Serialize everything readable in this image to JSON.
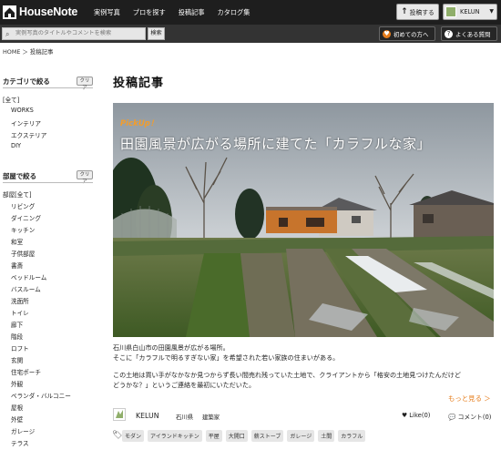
{
  "header": {
    "logo_text": "HouseNote",
    "nav": [
      "実例写真",
      "プロを探す",
      "投稿記事",
      "カタログ集"
    ],
    "post_button": "投稿する",
    "user_name": "KELUN"
  },
  "search": {
    "placeholder": "実例写真のタイトルやコメントを検索",
    "button": "検索",
    "beginner_button": "初めての方へ",
    "faq_button": "よくある質問"
  },
  "breadcrumb": "HOME ＞ 投稿記事",
  "sidebar": {
    "category_title": "カテゴリで絞る",
    "clear_label": "クリア",
    "category_items": [
      "[全て]",
      "WORKS",
      "インテリア",
      "エクステリア",
      "DIY"
    ],
    "room_title": "部屋で絞る",
    "room_items": [
      "部屋[全て]",
      "リビング",
      "ダイニング",
      "キッチン",
      "和室",
      "子供部屋",
      "書斎",
      "ベッドルーム",
      "バスルーム",
      "洗面所",
      "トイレ",
      "廊下",
      "階段",
      "ロフト",
      "玄関",
      "住宅ポーチ",
      "外観",
      "ベランダ・バルコニー",
      "屋根",
      "外壁",
      "ガレージ",
      "テラス"
    ]
  },
  "main": {
    "page_title": "投稿記事",
    "pickup_label": "PickUp！",
    "hero_title": "田園風景が広がる場所に建てた「カラフルな家」",
    "desc1": "石川県白山市の田園風景が広がる場所。",
    "desc2": "そこに「カラフルで明るすぎない家」を希望された若い家族の住まいがある。",
    "desc3": "この土地は買い手がなかなか見つからず長い間売れ残っていた土地で、クライアントから「格安の土地見つけたんだけど",
    "desc4": "どうかな？」というご連絡を最初にいただいた。",
    "more_link": "もっと見る ＞",
    "author": "KELUN",
    "location": "石川県",
    "category": "建築家",
    "like": "Like(0)",
    "comment": "コメント(0)",
    "tags": [
      "モダン",
      "アイランドキッチン",
      "平屋",
      "大開口",
      "薪ストーブ",
      "ガレージ",
      "土間",
      "カラフル"
    ]
  },
  "colors": {
    "header_bg": "#1e1e1e",
    "searchbar_bg": "#333333",
    "pickup": "#f29d2c",
    "more_link": "#e67d1c"
  }
}
